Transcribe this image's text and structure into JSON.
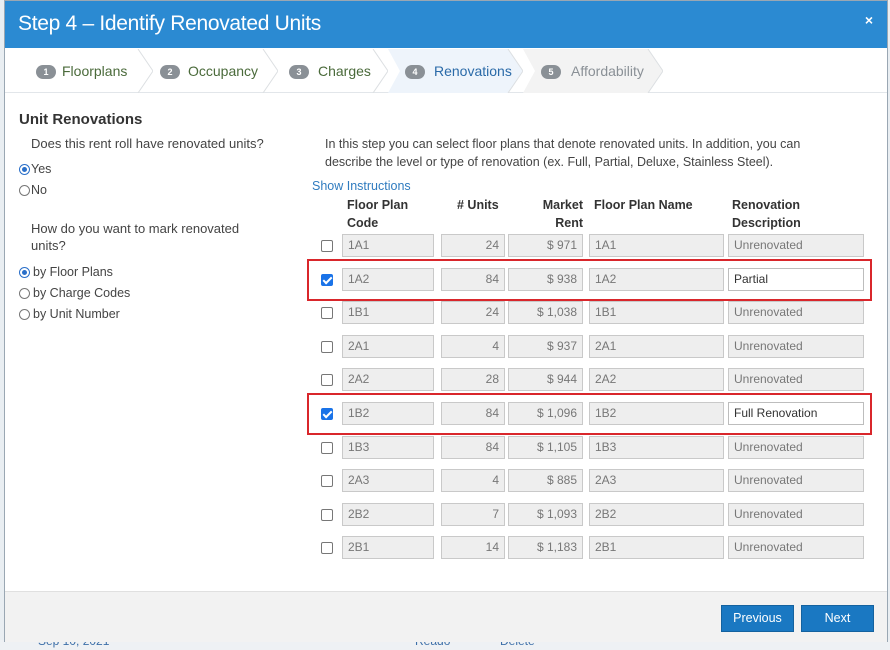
{
  "backdrop": {
    "left_text": "Sep 10, 2021",
    "mid_text": "Reado",
    "right_text": "Delete"
  },
  "header": {
    "title": "Step 4 – Identify Renovated Units",
    "close_label": "×"
  },
  "steps": [
    {
      "num": "1",
      "label": "Floorplans",
      "state": "done"
    },
    {
      "num": "2",
      "label": "Occupancy",
      "state": "done"
    },
    {
      "num": "3",
      "label": "Charges",
      "state": "done"
    },
    {
      "num": "4",
      "label": "Renovations",
      "state": "active"
    },
    {
      "num": "5",
      "label": "Affordability",
      "state": "future"
    }
  ],
  "left": {
    "title": "Unit Renovations",
    "q1": "Does this rent roll have renovated units?",
    "q1_options": [
      {
        "label": "Yes",
        "selected": true
      },
      {
        "label": "No",
        "selected": false
      }
    ],
    "q2_line1": "How do you want to mark renovated",
    "q2_line2": "units?",
    "q2_options": [
      {
        "label": "by Floor Plans",
        "selected": true
      },
      {
        "label": "by Charge Codes",
        "selected": false
      },
      {
        "label": "by Unit Number",
        "selected": false
      }
    ]
  },
  "right": {
    "intro_line1": "In this step you can select floor plans that denote renovated units. In addition, you can",
    "intro_line2": "describe the level or type of renovation (ex. Full, Partial, Deluxe, Stainless Steel).",
    "show_instructions": "Show Instructions",
    "headers": {
      "code_1": "Floor Plan",
      "code_2": "Code",
      "units": "# Units",
      "rent_1": "Market",
      "rent_2": "Rent",
      "name": "Floor Plan Name",
      "desc_1": "Renovation",
      "desc_2": "Description"
    },
    "rows": [
      {
        "checked": false,
        "code": "1A1",
        "units": "24",
        "rent": "$ 971",
        "name": "1A1",
        "desc": "Unrenovated"
      },
      {
        "checked": true,
        "code": "1A2",
        "units": "84",
        "rent": "$ 938",
        "name": "1A2",
        "desc": "Partial"
      },
      {
        "checked": false,
        "code": "1B1",
        "units": "24",
        "rent": "$ 1,038",
        "name": "1B1",
        "desc": "Unrenovated"
      },
      {
        "checked": false,
        "code": "2A1",
        "units": "4",
        "rent": "$ 937",
        "name": "2A1",
        "desc": "Unrenovated"
      },
      {
        "checked": false,
        "code": "2A2",
        "units": "28",
        "rent": "$ 944",
        "name": "2A2",
        "desc": "Unrenovated"
      },
      {
        "checked": true,
        "code": "1B2",
        "units": "84",
        "rent": "$ 1,096",
        "name": "1B2",
        "desc": "Full Renovation"
      },
      {
        "checked": false,
        "code": "1B3",
        "units": "84",
        "rent": "$ 1,105",
        "name": "1B3",
        "desc": "Unrenovated"
      },
      {
        "checked": false,
        "code": "2A3",
        "units": "4",
        "rent": "$ 885",
        "name": "2A3",
        "desc": "Unrenovated"
      },
      {
        "checked": false,
        "code": "2B2",
        "units": "7",
        "rent": "$ 1,093",
        "name": "2B2",
        "desc": "Unrenovated"
      },
      {
        "checked": false,
        "code": "2B1",
        "units": "14",
        "rent": "$ 1,183",
        "name": "2B1",
        "desc": "Unrenovated"
      }
    ]
  },
  "footer": {
    "previous": "Previous",
    "next": "Next"
  },
  "colors": {
    "header": "#2b8ad2",
    "button": "#1a78c2",
    "highlight": "#d9262b",
    "link": "#2f7bbf"
  }
}
